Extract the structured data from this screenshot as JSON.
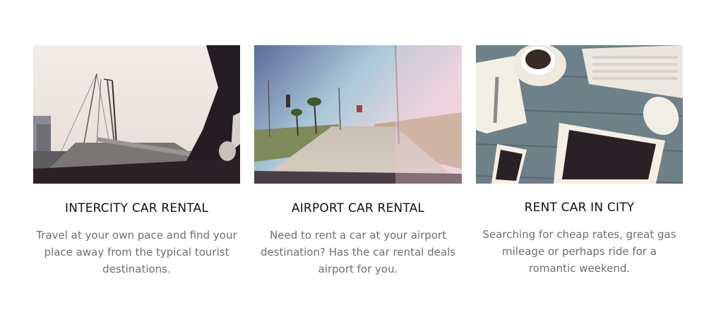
{
  "services": [
    {
      "image": "car-interior-bridge-photo",
      "title": "INTERCITY CAR RENTAL",
      "description": "Travel at your own pace and find your place away from the typical tourist destinations."
    },
    {
      "image": "airport-road-palms-photo",
      "title": "AIRPORT CAR RENTAL",
      "description": "Need to rent a car at your airport destination? Has the car rental deals airport for you."
    },
    {
      "image": "desk-keyboard-tablet-coffee-photo",
      "title": "RENT CAR IN CITY",
      "description": "Searching for cheap rates, great gas mileage or perhaps ride for a romantic weekend."
    }
  ]
}
